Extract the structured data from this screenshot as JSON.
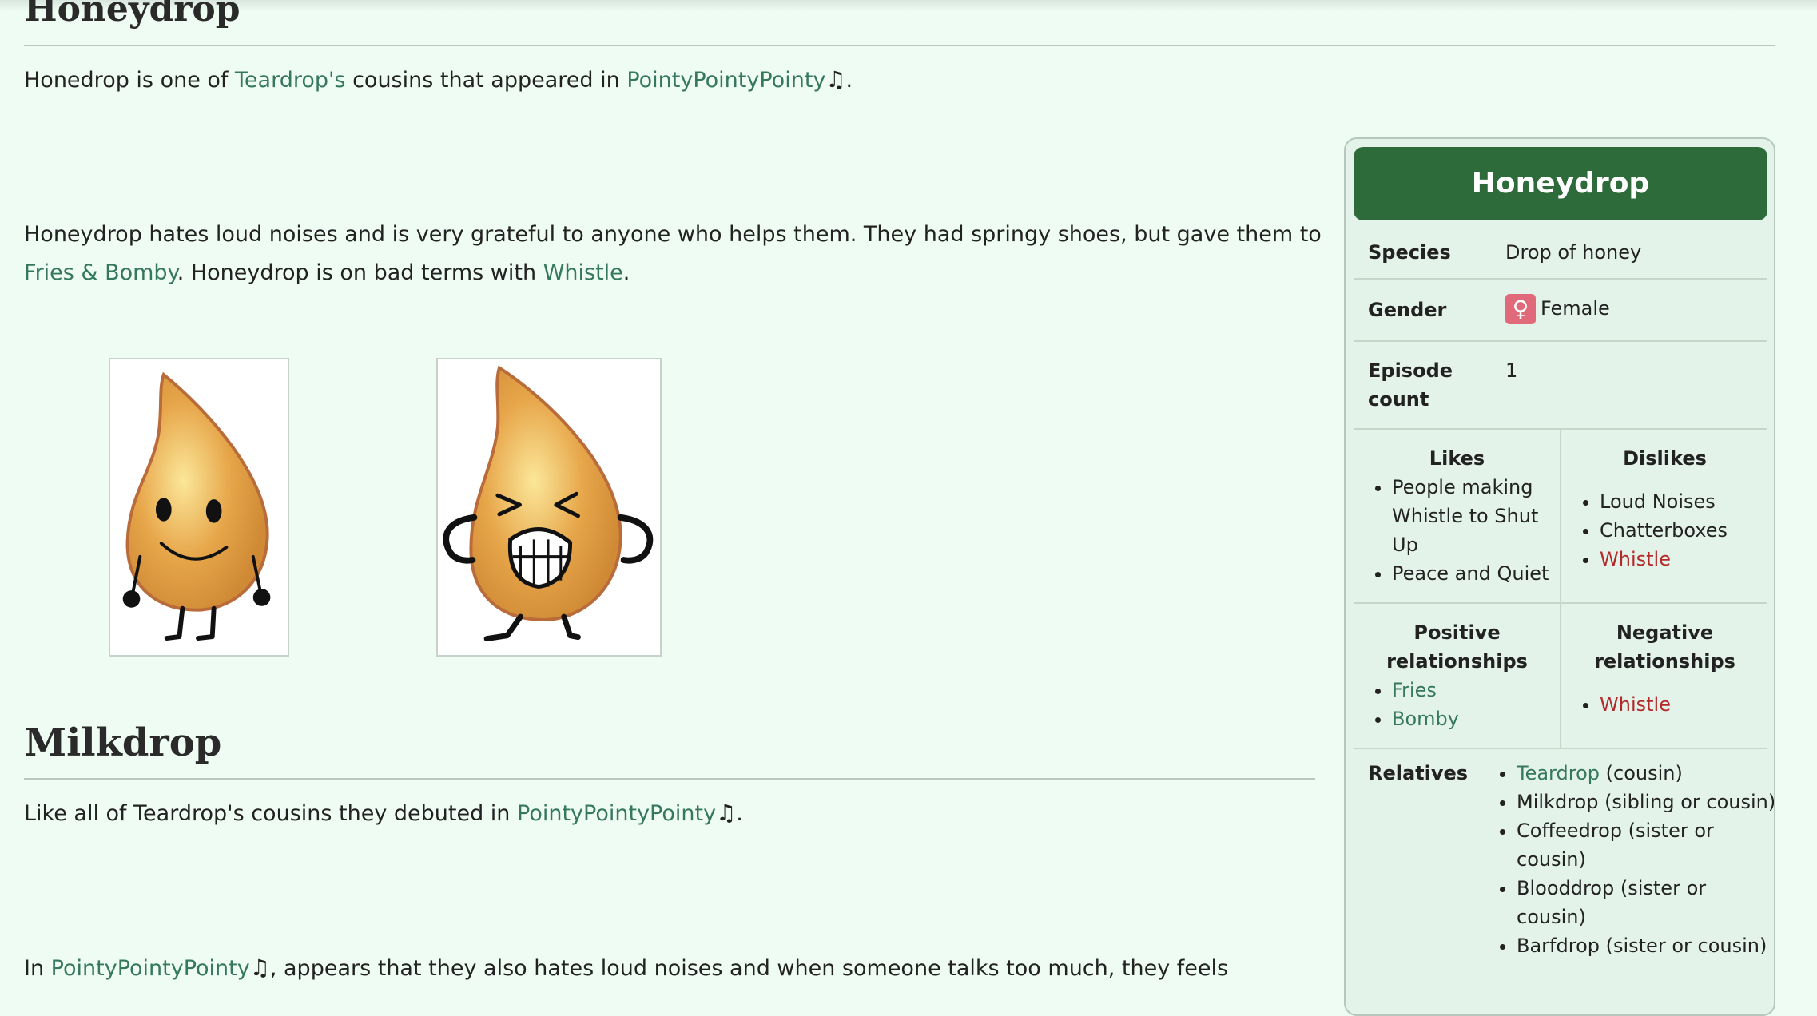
{
  "sections": {
    "honeydrop": {
      "heading": "Honeydrop",
      "intro": {
        "t1": "Honedrop is one of ",
        "link1": "Teardrop's",
        "t2": " cousins that appeared in ",
        "link2": "PointyPointyPointy",
        "note": "♫",
        "t3": "."
      },
      "desc": {
        "t1": "Honeydrop hates loud noises and is very grateful to anyone who helps them. They had springy shoes, but gave them to ",
        "link1": "Fries & Bomby",
        "t2": ". Honeydrop is on bad terms with ",
        "link2": "Whistle",
        "t3": "."
      }
    },
    "milkdrop": {
      "heading": "Milkdrop",
      "intro": {
        "t1": "Like all of Teardrop's cousins they debuted in ",
        "link1": "PointyPointyPointy",
        "note": "♫",
        "t2": "."
      },
      "desc": {
        "t1": "In ",
        "link1": "PointyPointyPointy",
        "note": "♫",
        "t2": ", appears that they also hates loud noises and when someone talks too much, they feels"
      }
    }
  },
  "infobox": {
    "title": "Honeydrop",
    "species_label": "Species",
    "species_value": "Drop of honey",
    "gender_label": "Gender",
    "gender_symbol": "♀",
    "gender_value": "Female",
    "episode_label_1": "Episode",
    "episode_label_2": "count",
    "episode_value": "1",
    "likes_label": "Likes",
    "likes": [
      "People making Whistle to Shut Up",
      "Peace and Quiet"
    ],
    "dislikes_label": "Dislikes",
    "dislikes": [
      "Loud Noises",
      "Chatterboxes",
      "Whistle"
    ],
    "positive_label_1": "Positive",
    "positive_label_2": "relationships",
    "positive": [
      "Fries",
      "Bomby"
    ],
    "negative_label_1": "Negative",
    "negative_label_2": "relationships",
    "negative": [
      "Whistle"
    ],
    "relatives_label": "Relatives",
    "relatives": [
      {
        "link": "Teardrop",
        "text": " (cousin)"
      },
      {
        "link": "",
        "text": "Milkdrop (sibling or cousin)"
      },
      {
        "link": "",
        "text": "Coffeedrop (sister or cousin)"
      },
      {
        "link": "",
        "text": "Blooddrop (sister or cousin)"
      },
      {
        "link": "",
        "text": "Barfdrop (sister or cousin)"
      }
    ]
  },
  "colors": {
    "background": "#eefcf3",
    "link": "#36775f",
    "link_red": "#b22a2a",
    "infobox_header": "#2d6b3b",
    "infobox_bg": "#e4f3ea",
    "female_badge": "#e06a7a"
  }
}
